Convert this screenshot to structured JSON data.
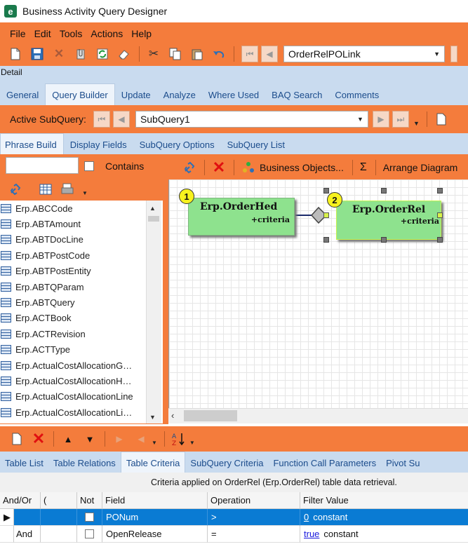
{
  "window": {
    "title": "Business Activity Query Designer",
    "app_icon_letter": "e"
  },
  "menu": [
    "File",
    "Edit",
    "Tools",
    "Actions",
    "Help"
  ],
  "toolbar": {
    "query_id": "OrderRelPOLink"
  },
  "section_label": "Detail",
  "main_tabs": [
    {
      "label": "General"
    },
    {
      "label": "Query Builder",
      "active": true
    },
    {
      "label": "Update"
    },
    {
      "label": "Analyze"
    },
    {
      "label": "Where Used"
    },
    {
      "label": "BAQ Search"
    },
    {
      "label": "Comments"
    }
  ],
  "subquery": {
    "label": "Active SubQuery:",
    "value": "SubQuery1"
  },
  "sub_tabs": [
    {
      "label": "Phrase Build",
      "active": true
    },
    {
      "label": "Display Fields"
    },
    {
      "label": "SubQuery Options"
    },
    {
      "label": "SubQuery List"
    }
  ],
  "left_panel": {
    "search_value": "",
    "contains_label": "Contains",
    "tables": [
      "Erp.ABCCode",
      "Erp.ABTAmount",
      "Erp.ABTDocLine",
      "Erp.ABTPostCode",
      "Erp.ABTPostEntity",
      "Erp.ABTQParam",
      "Erp.ABTQuery",
      "Erp.ACTBook",
      "Erp.ACTRevision",
      "Erp.ACTType",
      "Erp.ActualCostAllocationG…",
      "Erp.ActualCostAllocationH…",
      "Erp.ActualCostAllocationLine",
      "Erp.ActualCostAllocationLi…"
    ]
  },
  "diagram": {
    "business_objects_label": "Business Objects...",
    "sigma_label": "Σ",
    "arrange_label": "Arrange Diagram",
    "nodes": [
      {
        "number": "1",
        "name": "Erp.OrderHed",
        "criteria": "+criteria"
      },
      {
        "number": "2",
        "name": "Erp.OrderRel",
        "criteria": "+criteria"
      }
    ]
  },
  "bottom_tabs": [
    {
      "label": "Table List"
    },
    {
      "label": "Table Relations"
    },
    {
      "label": "Table Criteria",
      "active": true
    },
    {
      "label": "SubQuery Criteria"
    },
    {
      "label": "Function Call Parameters"
    },
    {
      "label": "Pivot Su"
    }
  ],
  "criteria": {
    "info": "Criteria applied on OrderRel (Erp.OrderRel)  table data retrieval.",
    "columns": [
      "And/Or",
      "(",
      "Not",
      "Field",
      "Operation",
      "Filter Value"
    ],
    "rows": [
      {
        "andor": "",
        "paren": "",
        "not": false,
        "field": "PONum",
        "operation": ">",
        "filter_link": "0",
        "filter_text": "constant",
        "selected": true
      },
      {
        "andor": "And",
        "paren": "",
        "not": false,
        "field": "OpenRelease",
        "operation": "=",
        "filter_link": "true",
        "filter_text": "constant",
        "selected": false
      }
    ]
  }
}
